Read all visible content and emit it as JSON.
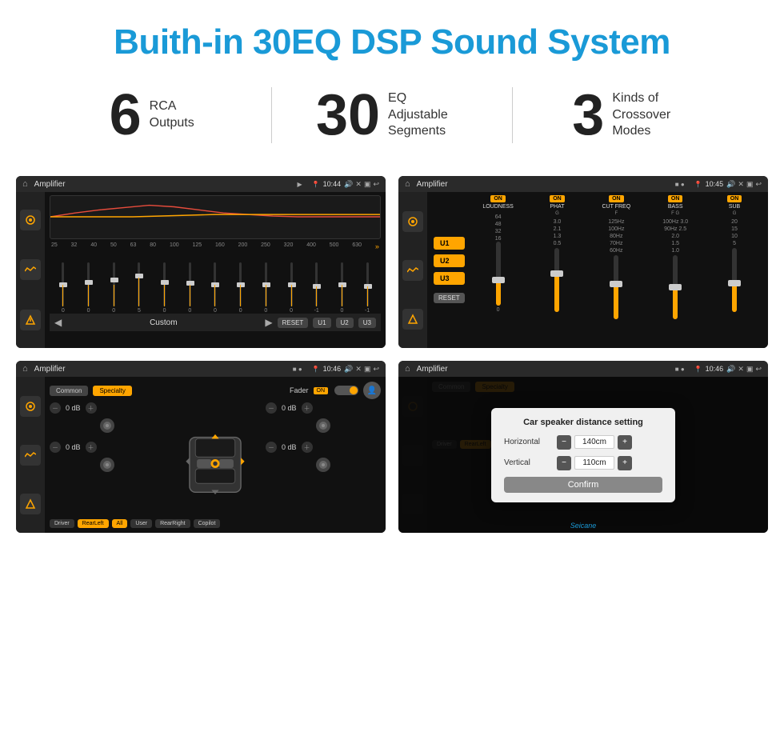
{
  "header": {
    "title": "Buith-in 30EQ DSP Sound System"
  },
  "stats": [
    {
      "number": "6",
      "label_line1": "RCA",
      "label_line2": "Outputs"
    },
    {
      "number": "30",
      "label_line1": "EQ Adjustable",
      "label_line2": "Segments"
    },
    {
      "number": "3",
      "label_line1": "Kinds of",
      "label_line2": "Crossover Modes"
    }
  ],
  "screens": {
    "eq": {
      "title": "Amplifier",
      "time": "10:44",
      "freqs": [
        "25",
        "32",
        "40",
        "50",
        "63",
        "80",
        "100",
        "125",
        "160",
        "200",
        "250",
        "320",
        "400",
        "500",
        "630"
      ],
      "values": [
        "0",
        "0",
        "0",
        "5",
        "0",
        "0",
        "0",
        "0",
        "0",
        "0",
        "-1",
        "0",
        "-1"
      ],
      "mode": "Custom",
      "presets": [
        "RESET",
        "U1",
        "U2",
        "U3"
      ]
    },
    "mixer": {
      "title": "Amplifier",
      "time": "10:45",
      "presets": [
        "U1",
        "U2",
        "U3"
      ],
      "channels": [
        {
          "on": true,
          "label": "LOUDNESS"
        },
        {
          "on": true,
          "label": "PHAT"
        },
        {
          "on": true,
          "label": "CUT FREQ"
        },
        {
          "on": true,
          "label": "BASS"
        },
        {
          "on": true,
          "label": "SUB"
        }
      ],
      "reset_label": "RESET"
    },
    "fader": {
      "title": "Amplifier",
      "time": "10:46",
      "tabs": [
        "Common",
        "Specialty"
      ],
      "active_tab": "Specialty",
      "fader_label": "Fader",
      "on_label": "ON",
      "zones": {
        "fl": "0 dB",
        "fr": "0 dB",
        "rl": "0 dB",
        "rr": "0 dB"
      },
      "bottom_btns": [
        "Driver",
        "RearLeft",
        "All",
        "User",
        "RearRight",
        "Copilot"
      ],
      "active_bottom": "All"
    },
    "dialog": {
      "title": "Amplifier",
      "time": "10:46",
      "dialog_title": "Car speaker distance setting",
      "horizontal_label": "Horizontal",
      "horizontal_value": "140cm",
      "vertical_label": "Vertical",
      "vertical_value": "110cm",
      "confirm_label": "Confirm"
    }
  },
  "watermark": "Seicane"
}
